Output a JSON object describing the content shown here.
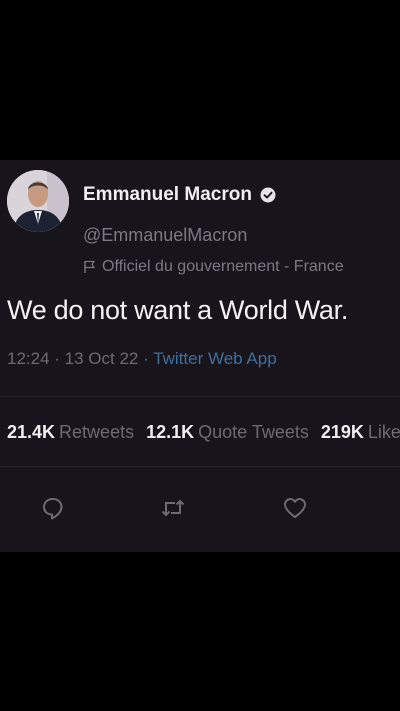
{
  "tweet": {
    "author": {
      "display_name": "Emmanuel Macron",
      "handle": "@EmmanuelMacron",
      "verified": true,
      "label": "Officiel du gouvernement - France"
    },
    "text": "We do not want a World War.",
    "time": "12:24",
    "date": "13 Oct 22",
    "source": "Twitter Web App",
    "stats": [
      {
        "count": "21.4K",
        "label": "Retweets"
      },
      {
        "count": "12.1K",
        "label": "Quote Tweets"
      },
      {
        "count": "219K",
        "label": "Likes"
      }
    ]
  },
  "colors": {
    "background": "#000000",
    "card": "#17141b",
    "link": "#3f6f9c"
  },
  "icons": [
    "verified-badge-icon",
    "government-flag-icon",
    "reply-icon",
    "retweet-icon",
    "like-icon"
  ]
}
